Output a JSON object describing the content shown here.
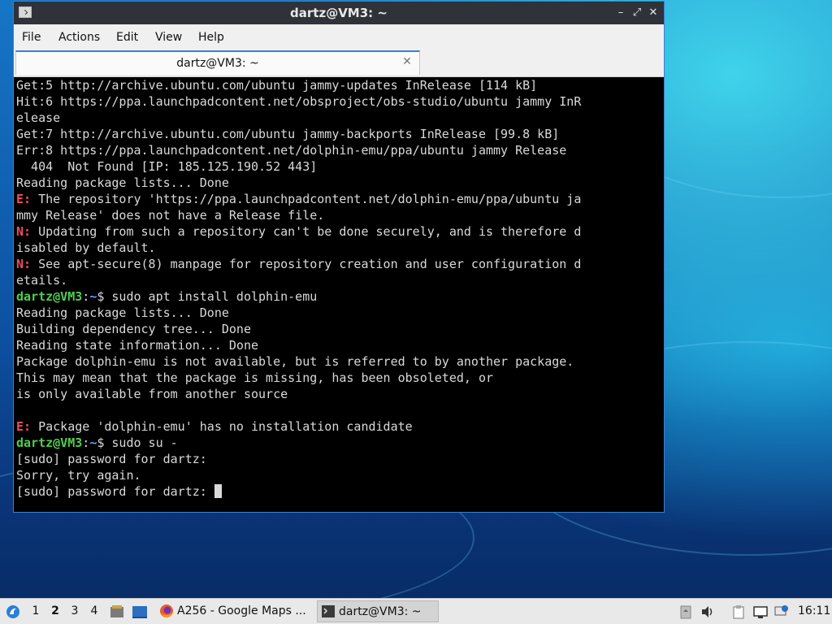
{
  "window": {
    "title": "dartz@VM3: ~",
    "controls": [
      "–",
      "⤢",
      "✕"
    ],
    "tab_label": "dartz@VM3: ~",
    "tab_close": "✕"
  },
  "menu": [
    "File",
    "Actions",
    "Edit",
    "View",
    "Help"
  ],
  "terminal": {
    "lines": [
      [
        {
          "t": "Get:5 http://archive.ubuntu.com/ubuntu jammy-updates InRelease [114 kB]"
        }
      ],
      [
        {
          "t": "Hit:6 https://ppa.launchpadcontent.net/obsproject/obs-studio/ubuntu jammy InR"
        }
      ],
      [
        {
          "t": "elease"
        }
      ],
      [
        {
          "t": "Get:7 http://archive.ubuntu.com/ubuntu jammy-backports InRelease [99.8 kB]"
        }
      ],
      [
        {
          "t": "Err:8 https://ppa.launchpadcontent.net/dolphin-emu/ppa/ubuntu jammy Release"
        }
      ],
      [
        {
          "t": "  404  Not Found [IP: 185.125.190.52 443]"
        }
      ],
      [
        {
          "t": "Reading package lists... Done"
        }
      ],
      [
        {
          "t": "E:",
          "c": "red"
        },
        {
          "t": " The repository 'https://ppa.launchpadcontent.net/dolphin-emu/ppa/ubuntu ja"
        }
      ],
      [
        {
          "t": "mmy Release' does not have a Release file."
        }
      ],
      [
        {
          "t": "N:",
          "c": "red"
        },
        {
          "t": " Updating from such a repository can't be done securely, and is therefore d"
        }
      ],
      [
        {
          "t": "isabled by default."
        }
      ],
      [
        {
          "t": "N:",
          "c": "red"
        },
        {
          "t": " See apt-secure(8) manpage for repository creation and user configuration d"
        }
      ],
      [
        {
          "t": "etails."
        }
      ],
      [
        {
          "t": "dartz@VM3",
          "c": "green"
        },
        {
          "t": ":"
        },
        {
          "t": "~",
          "c": "blue"
        },
        {
          "t": "$ sudo apt install dolphin-emu"
        }
      ],
      [
        {
          "t": "Reading package lists... Done"
        }
      ],
      [
        {
          "t": "Building dependency tree... Done"
        }
      ],
      [
        {
          "t": "Reading state information... Done"
        }
      ],
      [
        {
          "t": "Package dolphin-emu is not available, but is referred to by another package."
        }
      ],
      [
        {
          "t": "This may mean that the package is missing, has been obsoleted, or"
        }
      ],
      [
        {
          "t": "is only available from another source"
        }
      ],
      [
        {
          "t": ""
        }
      ],
      [
        {
          "t": "E:",
          "c": "red"
        },
        {
          "t": " Package 'dolphin-emu' has no installation candidate"
        }
      ],
      [
        {
          "t": "dartz@VM3",
          "c": "green"
        },
        {
          "t": ":"
        },
        {
          "t": "~",
          "c": "blue"
        },
        {
          "t": "$ sudo su -"
        }
      ],
      [
        {
          "t": "[sudo] password for dartz:"
        }
      ],
      [
        {
          "t": "Sorry, try again."
        }
      ],
      [
        {
          "t": "[sudo] password for dartz: "
        },
        {
          "cursor": true
        }
      ]
    ]
  },
  "taskbar": {
    "workspaces": [
      "1",
      "2",
      "3",
      "4"
    ],
    "active_workspace": "2",
    "tasks": [
      {
        "label": "A256 - Google Maps ...",
        "icon": "firefox-icon"
      },
      {
        "label": "dartz@VM3: ~",
        "icon": "terminal-icon"
      }
    ],
    "clock": "16:11"
  },
  "colors": {
    "prompt_user": "#4ed04e",
    "prompt_path": "#6f9cf5",
    "error_tag": "#ee4f5d",
    "terminal_bg": "#000000",
    "titlebar_bg": "#2f3238"
  }
}
